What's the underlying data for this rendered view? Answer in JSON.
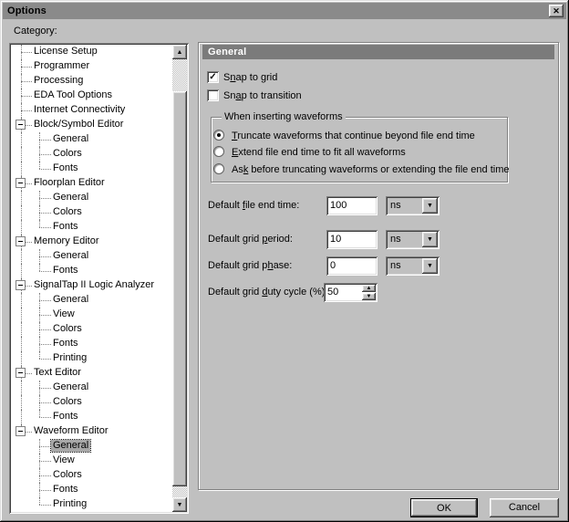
{
  "window": {
    "title": "Options"
  },
  "icons": {
    "close": "✕",
    "up": "▲",
    "down": "▼",
    "check": "✓"
  },
  "category": {
    "label": "Category:",
    "items": [
      {
        "t": "License Setup",
        "d": 0,
        "p": false,
        "r": "f",
        "c": "n",
        "s": false
      },
      {
        "t": "Programmer",
        "d": 0,
        "p": false,
        "r": "f",
        "c": "n",
        "s": false
      },
      {
        "t": "Processing",
        "d": 0,
        "p": false,
        "r": "f",
        "c": "n",
        "s": false
      },
      {
        "t": "EDA Tool Options",
        "d": 0,
        "p": false,
        "r": "f",
        "c": "n",
        "s": false
      },
      {
        "t": "Internet Connectivity",
        "d": 0,
        "p": false,
        "r": "f",
        "c": "n",
        "s": false
      },
      {
        "t": "Block/Symbol Editor",
        "d": 0,
        "p": true,
        "r": "f",
        "c": "n",
        "s": false
      },
      {
        "t": "General",
        "d": 1,
        "p": false,
        "r": "f",
        "c": "f",
        "s": false
      },
      {
        "t": "Colors",
        "d": 1,
        "p": false,
        "r": "f",
        "c": "f",
        "s": false
      },
      {
        "t": "Fonts",
        "d": 1,
        "p": false,
        "r": "f",
        "c": "h",
        "s": false
      },
      {
        "t": "Floorplan Editor",
        "d": 0,
        "p": true,
        "r": "f",
        "c": "n",
        "s": false
      },
      {
        "t": "General",
        "d": 1,
        "p": false,
        "r": "f",
        "c": "f",
        "s": false
      },
      {
        "t": "Colors",
        "d": 1,
        "p": false,
        "r": "f",
        "c": "f",
        "s": false
      },
      {
        "t": "Fonts",
        "d": 1,
        "p": false,
        "r": "f",
        "c": "h",
        "s": false
      },
      {
        "t": "Memory Editor",
        "d": 0,
        "p": true,
        "r": "f",
        "c": "n",
        "s": false
      },
      {
        "t": "General",
        "d": 1,
        "p": false,
        "r": "f",
        "c": "f",
        "s": false
      },
      {
        "t": "Fonts",
        "d": 1,
        "p": false,
        "r": "f",
        "c": "h",
        "s": false
      },
      {
        "t": "SignalTap II Logic Analyzer",
        "d": 0,
        "p": true,
        "r": "f",
        "c": "n",
        "s": false
      },
      {
        "t": "General",
        "d": 1,
        "p": false,
        "r": "f",
        "c": "f",
        "s": false
      },
      {
        "t": "View",
        "d": 1,
        "p": false,
        "r": "f",
        "c": "f",
        "s": false
      },
      {
        "t": "Colors",
        "d": 1,
        "p": false,
        "r": "f",
        "c": "f",
        "s": false
      },
      {
        "t": "Fonts",
        "d": 1,
        "p": false,
        "r": "f",
        "c": "f",
        "s": false
      },
      {
        "t": "Printing",
        "d": 1,
        "p": false,
        "r": "f",
        "c": "h",
        "s": false
      },
      {
        "t": "Text Editor",
        "d": 0,
        "p": true,
        "r": "f",
        "c": "n",
        "s": false
      },
      {
        "t": "General",
        "d": 1,
        "p": false,
        "r": "f",
        "c": "f",
        "s": false
      },
      {
        "t": "Colors",
        "d": 1,
        "p": false,
        "r": "f",
        "c": "f",
        "s": false
      },
      {
        "t": "Fonts",
        "d": 1,
        "p": false,
        "r": "f",
        "c": "h",
        "s": false
      },
      {
        "t": "Waveform Editor",
        "d": 0,
        "p": true,
        "r": "h",
        "c": "n",
        "s": false
      },
      {
        "t": "General",
        "d": 1,
        "p": false,
        "r": "n",
        "c": "f",
        "s": true
      },
      {
        "t": "View",
        "d": 1,
        "p": false,
        "r": "n",
        "c": "f",
        "s": false
      },
      {
        "t": "Colors",
        "d": 1,
        "p": false,
        "r": "n",
        "c": "f",
        "s": false
      },
      {
        "t": "Fonts",
        "d": 1,
        "p": false,
        "r": "n",
        "c": "f",
        "s": false
      },
      {
        "t": "Printing",
        "d": 1,
        "p": false,
        "r": "n",
        "c": "h",
        "s": false
      }
    ]
  },
  "panel": {
    "header": "General",
    "checkboxes": [
      {
        "pre": "S",
        "accel": "n",
        "post": "ap to grid",
        "checked": true
      },
      {
        "pre": "Sn",
        "accel": "a",
        "post": "p to transition",
        "checked": false
      }
    ],
    "radio_group": {
      "title": "When inserting waveforms",
      "options": [
        {
          "pre": "",
          "accel": "T",
          "post": "runcate waveforms that continue beyond file end time",
          "selected": true
        },
        {
          "pre": "",
          "accel": "E",
          "post": "xtend file end time to fit all waveforms",
          "selected": false
        },
        {
          "pre": "As",
          "accel": "k",
          "post": " before truncating waveforms or extending the file end time",
          "selected": false
        }
      ]
    },
    "fields": [
      {
        "pre": "Default ",
        "accel": "f",
        "post": "ile end time:",
        "value": "100",
        "unit": "ns"
      },
      {
        "pre": "Default grid ",
        "accel": "p",
        "post": "eriod:",
        "value": "10",
        "unit": "ns"
      },
      {
        "pre": "Default grid p",
        "accel": "h",
        "post": "ase:",
        "value": "0",
        "unit": "ns"
      },
      {
        "pre": "Default grid ",
        "accel": "d",
        "post": "uty cycle (%):",
        "value": "50"
      }
    ]
  },
  "buttons": {
    "ok": "OK",
    "cancel": "Cancel"
  },
  "colors": {
    "face": "#c0c0c0",
    "titlebar": "#8a8a8a",
    "panel_header": "#7b7b7b",
    "selection": "#a8a8a8"
  }
}
